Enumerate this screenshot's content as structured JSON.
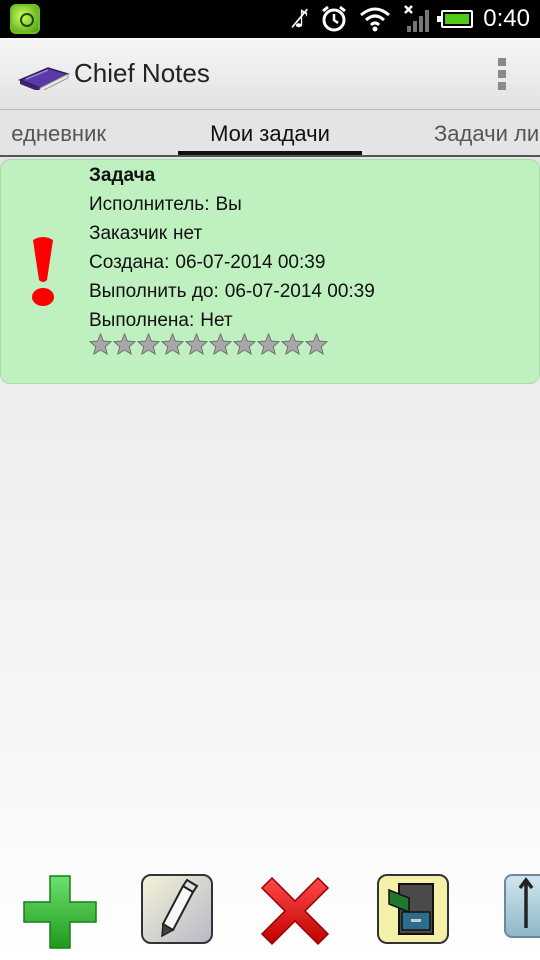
{
  "status_bar": {
    "time": "0:40",
    "icons": [
      "app-shield-icon",
      "muted-icon",
      "alarm-icon",
      "wifi-icon",
      "signal-icon",
      "battery-icon"
    ]
  },
  "action_bar": {
    "title": "Chief Notes",
    "logo": "book-icon",
    "overflow": "overflow-menu-icon"
  },
  "tabs": [
    {
      "label": "Ежедневник",
      "visible_text": "едневник",
      "selected": false
    },
    {
      "label": "Мои задачи",
      "selected": true
    },
    {
      "label": "Задачи ли",
      "selected": false
    }
  ],
  "task": {
    "title": "Задача",
    "priority_icon": "exclamation-icon",
    "fields": {
      "assignee_label": "Исполнитель:",
      "assignee_value": "Вы",
      "customer_label": "Заказчик",
      "customer_value": "нет",
      "created_label": "Создана:",
      "created_value": "06-07-2014 00:39",
      "due_label": "Выполнить до:",
      "due_value": "06-07-2014 00:39",
      "done_label": "Выполнена:",
      "done_value": "Нет"
    },
    "rating": {
      "filled": 0,
      "total": 10
    },
    "background": "#bff0bf"
  },
  "toolbar": {
    "buttons": [
      "add-icon",
      "edit-pencil-icon",
      "delete-x-icon",
      "archive-cabinet-icon",
      "scroll-up-icon"
    ]
  },
  "colors": {
    "accent_green": "#2fb82f",
    "delete_red": "#e01010",
    "priority_red": "#ff0000"
  }
}
